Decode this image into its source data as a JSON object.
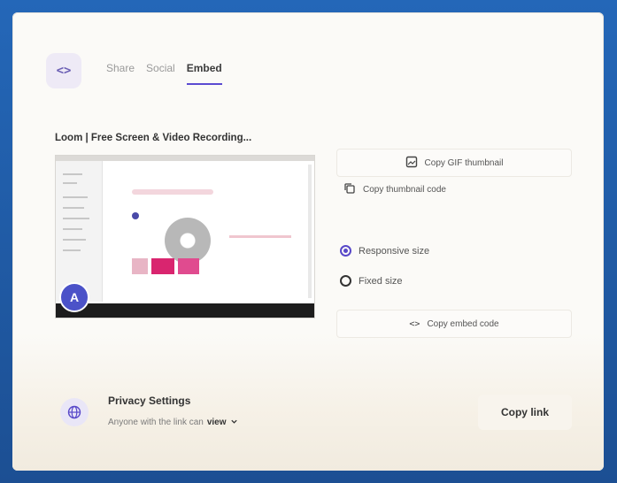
{
  "header": {
    "code_icon_glyph": "<>",
    "tabs": [
      {
        "label": "Share"
      },
      {
        "label": "Social"
      },
      {
        "label": "Embed"
      }
    ],
    "active_tab": "Embed"
  },
  "video": {
    "title": "Loom | Free Screen & Video Recording...",
    "avatar_letter": "A"
  },
  "actions": {
    "copy_gif_label": "Copy GIF thumbnail",
    "copy_thumbnail_label": "Copy thumbnail code",
    "size_options": [
      {
        "label": "Responsive size",
        "selected": true
      },
      {
        "label": "Fixed size",
        "selected": false
      }
    ],
    "copy_embed_label": "Copy embed code"
  },
  "footer": {
    "privacy_title": "Privacy Settings",
    "privacy_prefix": "Anyone with the link can",
    "privacy_value": "view",
    "copy_link_label": "Copy link"
  },
  "colors": {
    "accent": "#5848c9",
    "frame": "#1f5aa6"
  }
}
